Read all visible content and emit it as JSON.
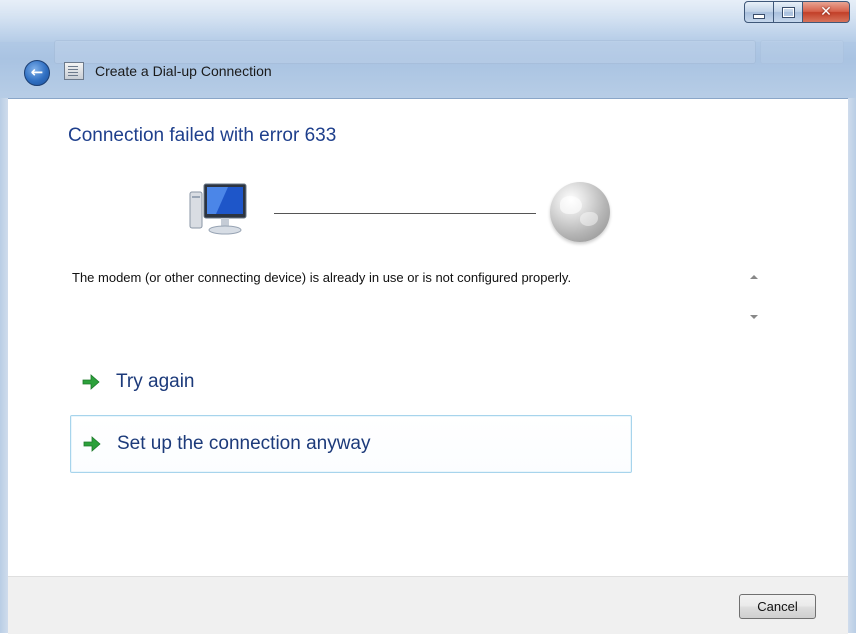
{
  "window": {
    "title": "Create a Dial-up Connection"
  },
  "content": {
    "heading": "Connection failed with error 633",
    "message": "The modem (or other connecting device) is already in use or is not configured properly.",
    "options": [
      {
        "label": "Try again"
      },
      {
        "label": "Set up the connection anyway"
      }
    ]
  },
  "footer": {
    "cancel_label": "Cancel"
  },
  "colors": {
    "heading": "#1e3f8c",
    "link_text": "#1c3a7a",
    "link_arrow": "#2ca13b",
    "highlight_border": "#a7d4ec"
  },
  "icons": [
    "back-arrow-icon",
    "dialup-connection-icon",
    "computer-icon",
    "globe-icon",
    "green-arrow-icon",
    "minimize-icon",
    "maximize-icon",
    "close-icon"
  ]
}
